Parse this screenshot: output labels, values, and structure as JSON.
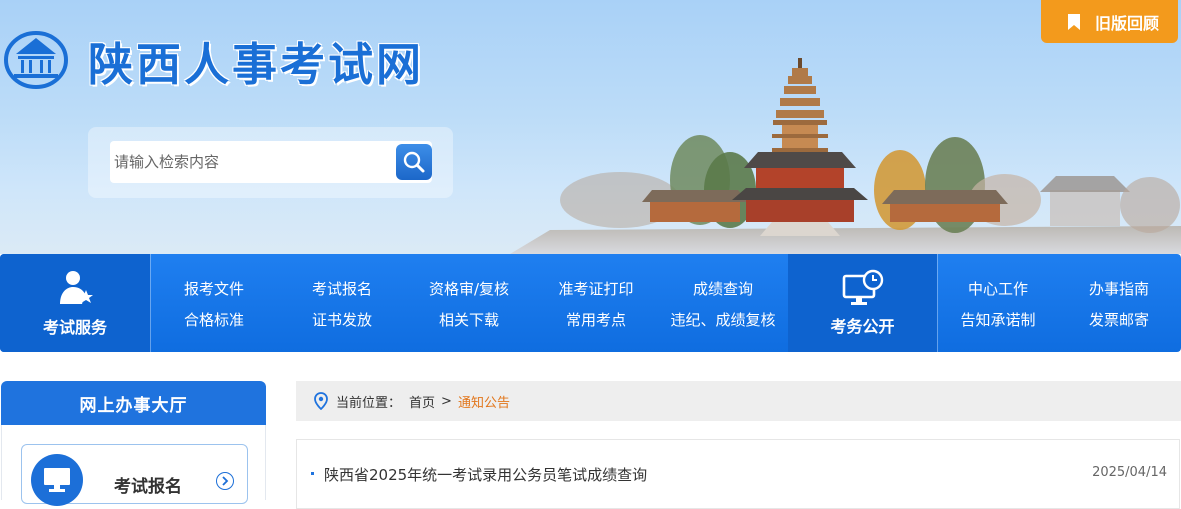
{
  "header": {
    "site_title": "陕西人事考试网",
    "search_placeholder": "请输入检索内容",
    "old_version_label": "旧版回顾"
  },
  "nav": {
    "exam_service_label": "考试服务",
    "links_row1": [
      "报考文件",
      "考试报名",
      "资格审/复核",
      "准考证打印",
      "成绩查询"
    ],
    "links_row2": [
      "合格标准",
      "证书发放",
      "相关下载",
      "常用考点",
      "违纪、成绩复核"
    ],
    "affairs_label": "考务公开",
    "right_row1": [
      "中心工作",
      "办事指南"
    ],
    "right_row2": [
      "告知承诺制",
      "发票邮寄"
    ]
  },
  "sidebar": {
    "title": "网上办事大厅",
    "card_label": "考试报名"
  },
  "breadcrumb": {
    "prefix": "当前位置：",
    "home": "首页",
    "separator": ">",
    "current": "通知公告"
  },
  "list": {
    "items": [
      {
        "title": "陕西省2025年统一考试录用公务员笔试成绩查询",
        "date": "2025/04/14"
      }
    ]
  },
  "colors": {
    "primary": "#1f73de",
    "accent_orange": "#f39a1c",
    "current_crumb": "#e2761b"
  }
}
